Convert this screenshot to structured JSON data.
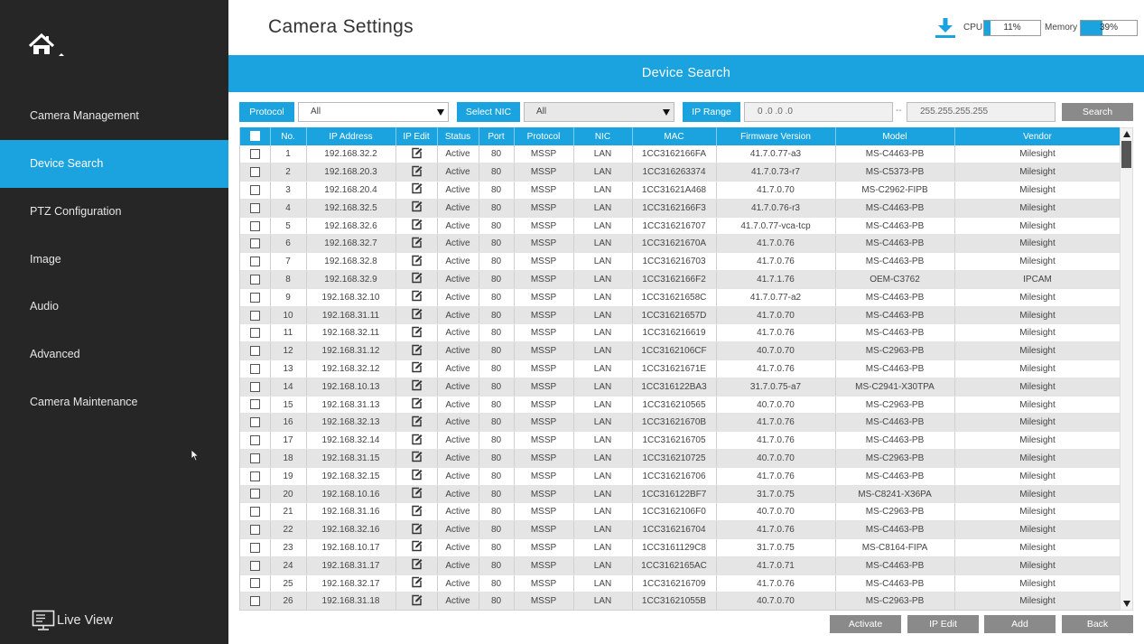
{
  "sidebar": {
    "items": [
      {
        "label": "Camera Management"
      },
      {
        "label": "Device Search"
      },
      {
        "label": "PTZ Configuration"
      },
      {
        "label": "Image"
      },
      {
        "label": "Audio"
      },
      {
        "label": "Advanced"
      },
      {
        "label": "Camera Maintenance"
      }
    ],
    "active_index": 1,
    "live_view_label": "Live View"
  },
  "header": {
    "title": "Camera Settings",
    "cpu_label": "CPU",
    "cpu_value": "11%",
    "cpu_fraction": 0.11,
    "memory_label": "Memory",
    "memory_value": "39%",
    "memory_fraction": 0.39
  },
  "banner": {
    "title": "Device Search"
  },
  "filters": {
    "protocol_label": "Protocol",
    "protocol_value": "All",
    "nic_label": "Select NIC",
    "nic_value": "All",
    "ip_range_label": "IP Range",
    "ip_start": "0 .0 .0 .0",
    "range_separator": "--",
    "ip_end": "255.255.255.255",
    "search_label": "Search"
  },
  "table": {
    "columns": [
      "",
      "No.",
      "IP Address",
      "IP Edit",
      "Status",
      "Port",
      "Protocol",
      "NIC",
      "MAC",
      "Firmware Version",
      "Model",
      "Vendor"
    ],
    "rows": [
      [
        "1",
        "192.168.32.2",
        "Active",
        "80",
        "MSSP",
        "LAN",
        "1CC3162166FA",
        "41.7.0.77-a3",
        "MS-C4463-PB",
        "Milesight"
      ],
      [
        "2",
        "192.168.20.3",
        "Active",
        "80",
        "MSSP",
        "LAN",
        "1CC316263374",
        "41.7.0.73-r7",
        "MS-C5373-PB",
        "Milesight"
      ],
      [
        "3",
        "192.168.20.4",
        "Active",
        "80",
        "MSSP",
        "LAN",
        "1CC31621A468",
        "41.7.0.70",
        "MS-C2962-FIPB",
        "Milesight"
      ],
      [
        "4",
        "192.168.32.5",
        "Active",
        "80",
        "MSSP",
        "LAN",
        "1CC3162166F3",
        "41.7.0.76-r3",
        "MS-C4463-PB",
        "Milesight"
      ],
      [
        "5",
        "192.168.32.6",
        "Active",
        "80",
        "MSSP",
        "LAN",
        "1CC316216707",
        "41.7.0.77-vca-tcp",
        "MS-C4463-PB",
        "Milesight"
      ],
      [
        "6",
        "192.168.32.7",
        "Active",
        "80",
        "MSSP",
        "LAN",
        "1CC31621670A",
        "41.7.0.76",
        "MS-C4463-PB",
        "Milesight"
      ],
      [
        "7",
        "192.168.32.8",
        "Active",
        "80",
        "MSSP",
        "LAN",
        "1CC316216703",
        "41.7.0.76",
        "MS-C4463-PB",
        "Milesight"
      ],
      [
        "8",
        "192.168.32.9",
        "Active",
        "80",
        "MSSP",
        "LAN",
        "1CC3162166F2",
        "41.7.1.76",
        "OEM-C3762",
        "IPCAM"
      ],
      [
        "9",
        "192.168.32.10",
        "Active",
        "80",
        "MSSP",
        "LAN",
        "1CC31621658C",
        "41.7.0.77-a2",
        "MS-C4463-PB",
        "Milesight"
      ],
      [
        "10",
        "192.168.31.11",
        "Active",
        "80",
        "MSSP",
        "LAN",
        "1CC31621657D",
        "41.7.0.70",
        "MS-C4463-PB",
        "Milesight"
      ],
      [
        "11",
        "192.168.32.11",
        "Active",
        "80",
        "MSSP",
        "LAN",
        "1CC316216619",
        "41.7.0.76",
        "MS-C4463-PB",
        "Milesight"
      ],
      [
        "12",
        "192.168.31.12",
        "Active",
        "80",
        "MSSP",
        "LAN",
        "1CC3162106CF",
        "40.7.0.70",
        "MS-C2963-PB",
        "Milesight"
      ],
      [
        "13",
        "192.168.32.12",
        "Active",
        "80",
        "MSSP",
        "LAN",
        "1CC31621671E",
        "41.7.0.76",
        "MS-C4463-PB",
        "Milesight"
      ],
      [
        "14",
        "192.168.10.13",
        "Active",
        "80",
        "MSSP",
        "LAN",
        "1CC316122BA3",
        "31.7.0.75-a7",
        "MS-C2941-X30TPA",
        "Milesight"
      ],
      [
        "15",
        "192.168.31.13",
        "Active",
        "80",
        "MSSP",
        "LAN",
        "1CC316210565",
        "40.7.0.70",
        "MS-C2963-PB",
        "Milesight"
      ],
      [
        "16",
        "192.168.32.13",
        "Active",
        "80",
        "MSSP",
        "LAN",
        "1CC31621670B",
        "41.7.0.76",
        "MS-C4463-PB",
        "Milesight"
      ],
      [
        "17",
        "192.168.32.14",
        "Active",
        "80",
        "MSSP",
        "LAN",
        "1CC316216705",
        "41.7.0.76",
        "MS-C4463-PB",
        "Milesight"
      ],
      [
        "18",
        "192.168.31.15",
        "Active",
        "80",
        "MSSP",
        "LAN",
        "1CC316210725",
        "40.7.0.70",
        "MS-C2963-PB",
        "Milesight"
      ],
      [
        "19",
        "192.168.32.15",
        "Active",
        "80",
        "MSSP",
        "LAN",
        "1CC316216706",
        "41.7.0.76",
        "MS-C4463-PB",
        "Milesight"
      ],
      [
        "20",
        "192.168.10.16",
        "Active",
        "80",
        "MSSP",
        "LAN",
        "1CC316122BF7",
        "31.7.0.75",
        "MS-C8241-X36PA",
        "Milesight"
      ],
      [
        "21",
        "192.168.31.16",
        "Active",
        "80",
        "MSSP",
        "LAN",
        "1CC3162106F0",
        "40.7.0.70",
        "MS-C2963-PB",
        "Milesight"
      ],
      [
        "22",
        "192.168.32.16",
        "Active",
        "80",
        "MSSP",
        "LAN",
        "1CC316216704",
        "41.7.0.76",
        "MS-C4463-PB",
        "Milesight"
      ],
      [
        "23",
        "192.168.10.17",
        "Active",
        "80",
        "MSSP",
        "LAN",
        "1CC3161129C8",
        "31.7.0.75",
        "MS-C8164-FIPA",
        "Milesight"
      ],
      [
        "24",
        "192.168.31.17",
        "Active",
        "80",
        "MSSP",
        "LAN",
        "1CC3162165AC",
        "41.7.0.71",
        "MS-C4463-PB",
        "Milesight"
      ],
      [
        "25",
        "192.168.32.17",
        "Active",
        "80",
        "MSSP",
        "LAN",
        "1CC316216709",
        "41.7.0.76",
        "MS-C4463-PB",
        "Milesight"
      ],
      [
        "26",
        "192.168.31.18",
        "Active",
        "80",
        "MSSP",
        "LAN",
        "1CC31621055B",
        "40.7.0.70",
        "MS-C2963-PB",
        "Milesight"
      ]
    ]
  },
  "buttons": {
    "activate": "Activate",
    "ip_edit": "IP Edit",
    "add": "Add",
    "back": "Back"
  },
  "colors": {
    "accent": "#1aa3df",
    "sidebar_bg": "#262626",
    "row_alt": "#e5e5e5",
    "button_grey": "#8a8a8a"
  },
  "icons": [
    "home-icon",
    "download-icon",
    "edit-icon",
    "monitor-icon",
    "mouse-cursor-icon",
    "dropdown-caret-icon",
    "scroll-up-icon",
    "scroll-down-icon"
  ]
}
